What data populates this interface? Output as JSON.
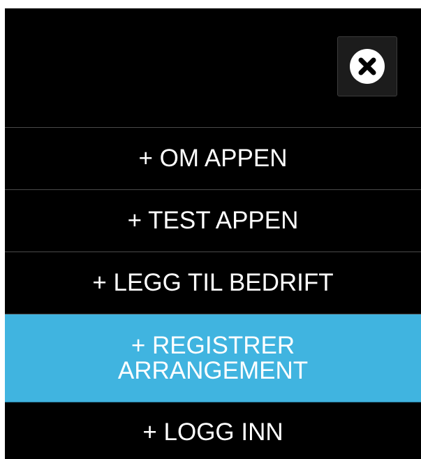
{
  "menu": {
    "close_icon": "close-icon",
    "items": [
      {
        "label": "+ OM APPEN"
      },
      {
        "label": "+ TEST APPEN"
      },
      {
        "label": "+ LEGG TIL BEDRIFT"
      },
      {
        "label": "+ REGISTRER ARRANGEMENT",
        "active": true
      },
      {
        "label": "+ LOGG INN"
      }
    ]
  },
  "colors": {
    "background": "#000000",
    "active_item": "#40b4e0",
    "text": "#ffffff",
    "divider": "#4a4a4a"
  }
}
